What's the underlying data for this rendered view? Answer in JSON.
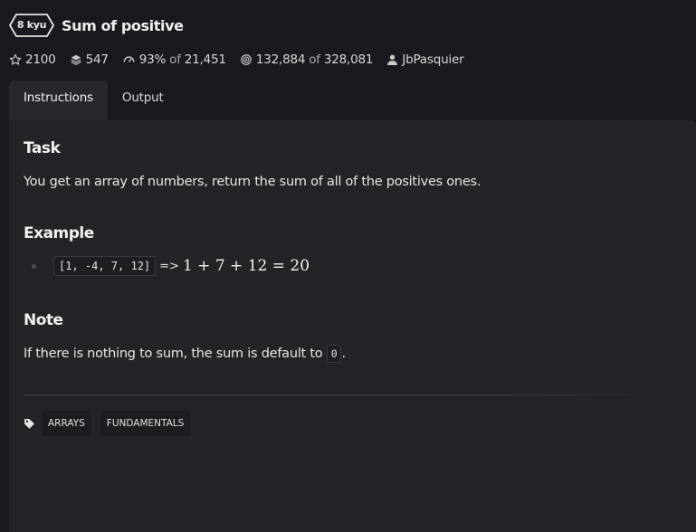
{
  "kata": {
    "rank": "8 kyu",
    "title": "Sum of positive"
  },
  "stats": {
    "stars": "2100",
    "collections": "547",
    "satisfaction": "93%",
    "satisfaction_of": "of",
    "votes": "21,451",
    "completed": "132,884",
    "completed_of": "of",
    "attempts": "328,081",
    "author": "JbPasquier"
  },
  "tabs": [
    {
      "label": "Instructions",
      "active": true
    },
    {
      "label": "Output",
      "active": false
    }
  ],
  "description": {
    "task_heading": "Task",
    "task_text": "You get an array of numbers, return the sum of all of the positives ones.",
    "example_heading": "Example",
    "example_code": "[1, -4, 7, 12]",
    "example_arrow": "=>",
    "example_math": "1 + 7 + 12 = 20",
    "note_heading": "Note",
    "note_text_before": "If there is nothing to sum, the sum is default to",
    "note_code": "0",
    "note_text_after": "."
  },
  "tags": [
    "ARRAYS",
    "FUNDAMENTALS"
  ],
  "colors": {
    "background": "#181a1f",
    "panel": "#232428",
    "text": "#e4e4e4"
  }
}
